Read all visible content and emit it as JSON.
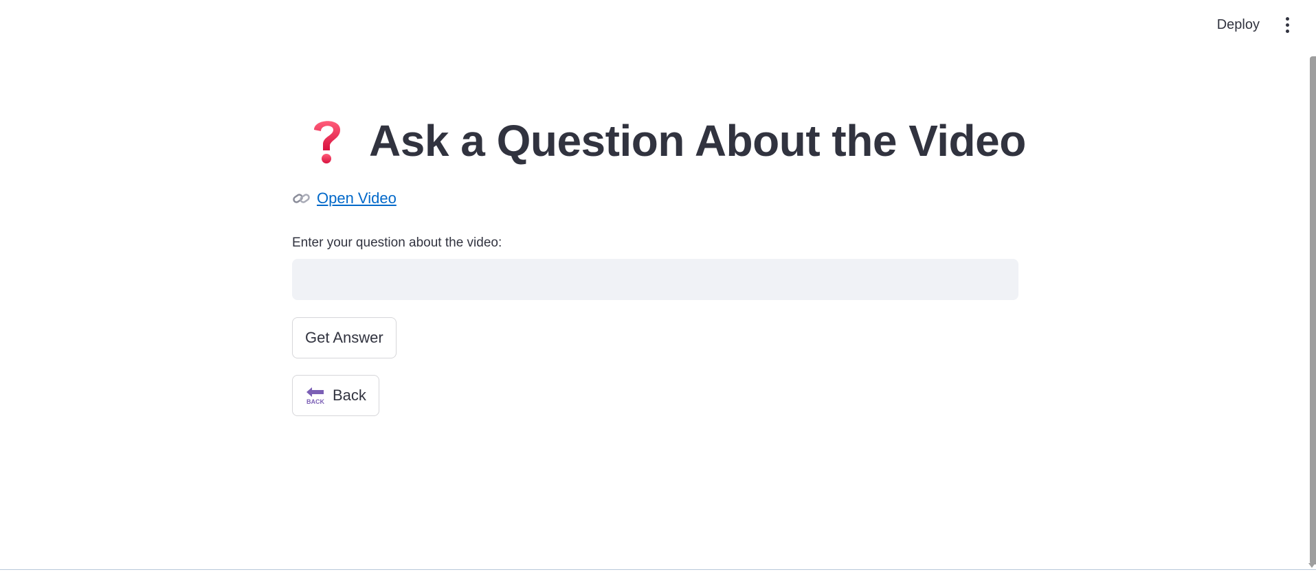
{
  "header": {
    "deploy_label": "Deploy",
    "menu_icon": "vertical-ellipsis-icon"
  },
  "main": {
    "title_icon": "red-question-mark-icon",
    "title": "Ask a Question About the Video",
    "open_video": {
      "icon": "link-icon",
      "label": "Open Video"
    },
    "question_field": {
      "label": "Enter your question about the video:",
      "value": "",
      "placeholder": ""
    },
    "get_answer_label": "Get Answer",
    "back": {
      "icon": "back-arrow-icon",
      "label": "Back"
    }
  },
  "colors": {
    "text": "#31333f",
    "link": "#0068c9",
    "input_bg": "#f0f2f6",
    "button_border": "#d6d6d9",
    "title_icon": "#e8194f",
    "back_icon": "#7b5fb5"
  }
}
